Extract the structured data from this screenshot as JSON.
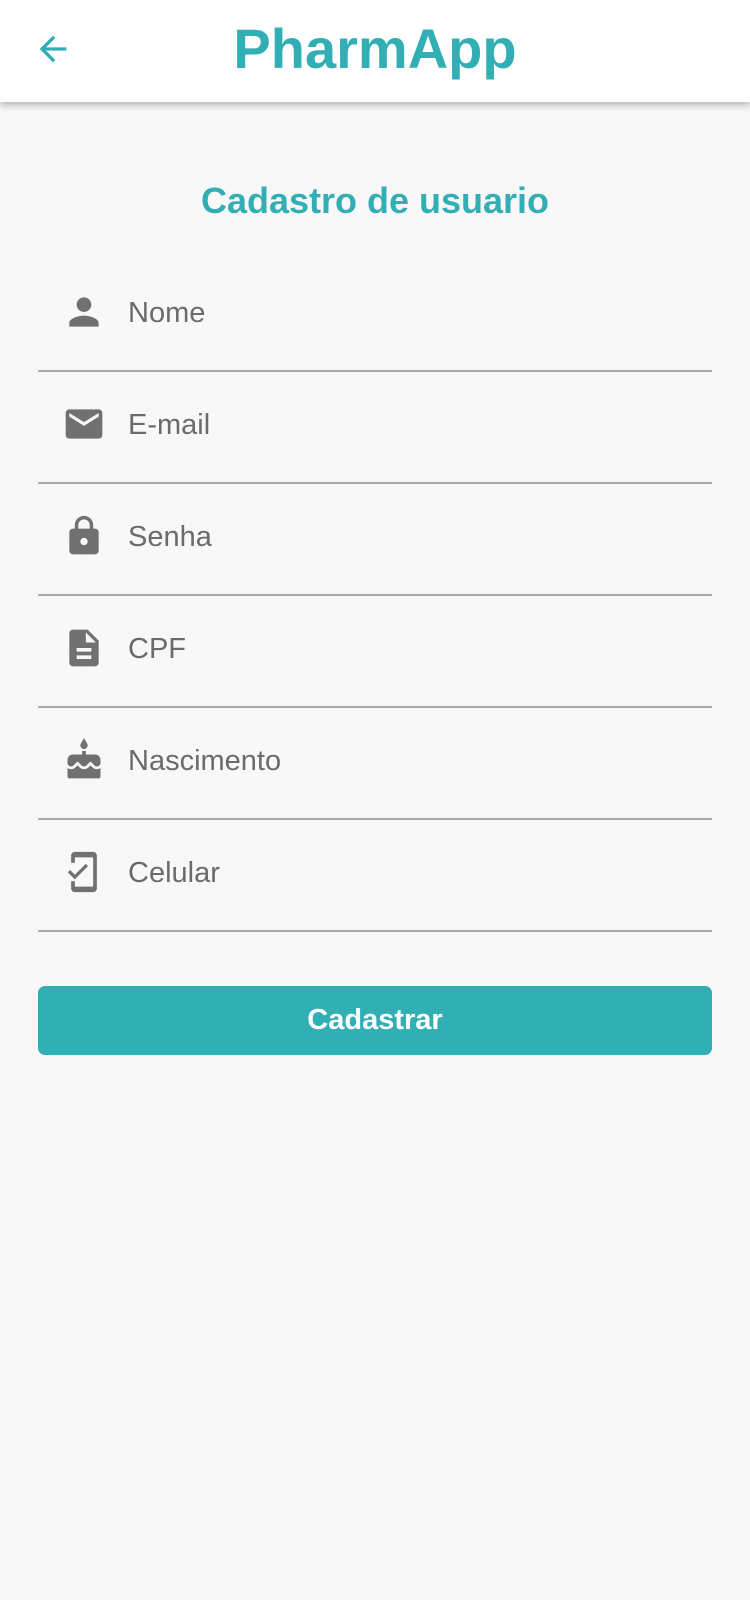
{
  "colors": {
    "accent": "#32afb5",
    "icon": "#707070",
    "background": "#f8f8f8",
    "appbar": "#ffffff"
  },
  "header": {
    "title": "PharmApp",
    "back_icon": "arrow-left-icon"
  },
  "form": {
    "title": "Cadastro de usuario",
    "fields": [
      {
        "placeholder": "Nome",
        "value": "",
        "icon": "person-icon"
      },
      {
        "placeholder": "E-mail",
        "value": "",
        "icon": "mail-icon"
      },
      {
        "placeholder": "Senha",
        "value": "",
        "icon": "lock-icon"
      },
      {
        "placeholder": "CPF",
        "value": "",
        "icon": "document-icon"
      },
      {
        "placeholder": "Nascimento",
        "value": "",
        "icon": "cake-icon"
      },
      {
        "placeholder": "Celular",
        "value": "",
        "icon": "phone-check-icon"
      }
    ],
    "submit_label": "Cadastrar"
  }
}
